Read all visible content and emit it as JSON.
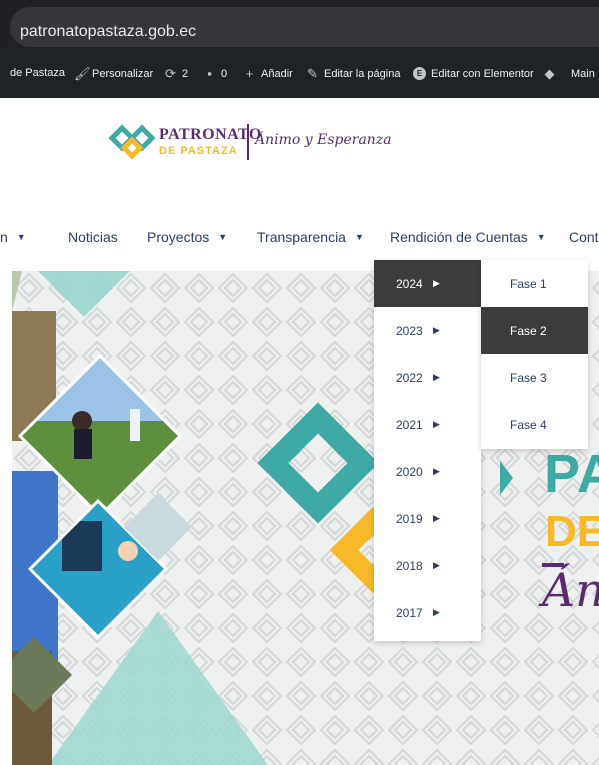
{
  "browser": {
    "url": "patronatopastaza.gob.ec"
  },
  "admin_bar": {
    "site_name": "de Pastaza",
    "customize": "Personalizar",
    "updates_count": "2",
    "comments_count": "0",
    "add_new": "Añadir",
    "edit_page": "Editar la página",
    "edit_elementor": "Editar con Elementor",
    "maintenance": "Main"
  },
  "logo": {
    "name_line1": "PATRONATO",
    "name_line2": "DE PASTAZA",
    "tagline": "Ánimo y Esperanza"
  },
  "nav": {
    "items": [
      {
        "label": "n",
        "has_dropdown": true
      },
      {
        "label": "Noticias",
        "has_dropdown": false
      },
      {
        "label": "Proyectos",
        "has_dropdown": true
      },
      {
        "label": "Transparencia",
        "has_dropdown": true
      },
      {
        "label": "Rendición de Cuentas",
        "has_dropdown": true
      },
      {
        "label": "Conta",
        "has_dropdown": false
      }
    ]
  },
  "dropdown_years": [
    "2024",
    "2023",
    "2022",
    "2021",
    "2020",
    "2019",
    "2018",
    "2017"
  ],
  "dropdown_years_active": "2024",
  "dropdown_phases": [
    "Fase 1",
    "Fase 2",
    "Fase 3",
    "Fase 4"
  ],
  "dropdown_phases_active": "Fase 2",
  "hero": {
    "banner_line1": "PA",
    "banner_line2": "DE",
    "banner_script": "Án"
  },
  "colors": {
    "teal": "#3fa9a3",
    "yellow": "#f7b928",
    "purple": "#5b2b6d",
    "navy": "#2a3d6e",
    "admin_bg": "#1d2327",
    "browser_bg": "#202124",
    "active_bg": "#3b3c3e"
  },
  "icons": [
    "brush-icon",
    "refresh-icon",
    "comment-icon",
    "plus-icon",
    "pencil-icon",
    "elementor-icon",
    "diamond-icon",
    "caret-down-icon",
    "caret-right-icon"
  ]
}
